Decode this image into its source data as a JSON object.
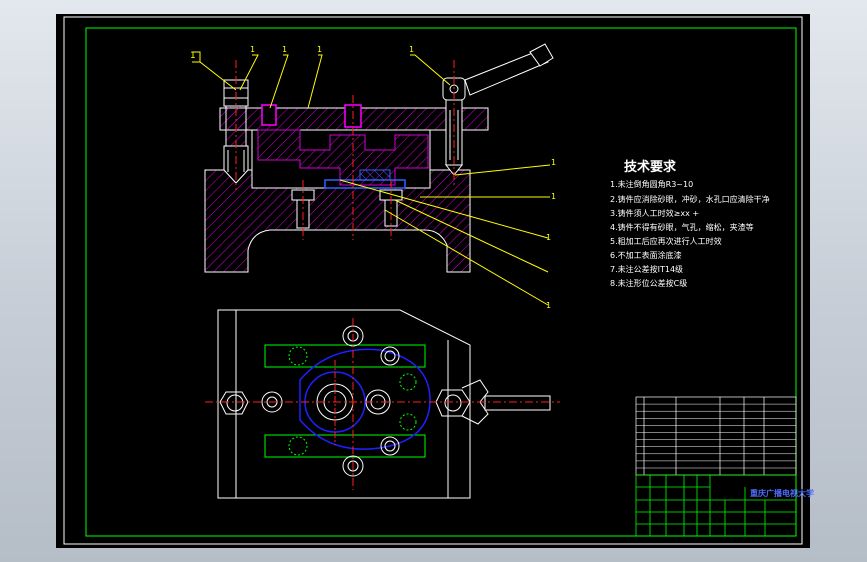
{
  "drawing": {
    "balloon_numbers": [
      "1",
      "1",
      "1",
      "1",
      "1",
      "1",
      "1",
      "1",
      "1"
    ],
    "tech_title": "技术要求",
    "tech_items": [
      "1.未注倒角圆角R3~10",
      "2.铸件应消除砂眼，冲砂，水孔口应清除干净",
      "3.铸件须人工时效≥xx +",
      "4.铸件不得有砂眼，气孔，缩松，夹渣等",
      "5.粗加工后应再次进行人工时效",
      "6.不加工表面涂底漆",
      "7.未注公差按IT14级",
      "8.未注形位公差按C级"
    ],
    "school": "重庆广播电视大学"
  },
  "colors": {
    "frame": "#00ff00",
    "hatch": "#d400d4",
    "part": "#ffffff",
    "leader": "#ffff00",
    "blue": "#2020ff",
    "center": "#ff2020"
  }
}
